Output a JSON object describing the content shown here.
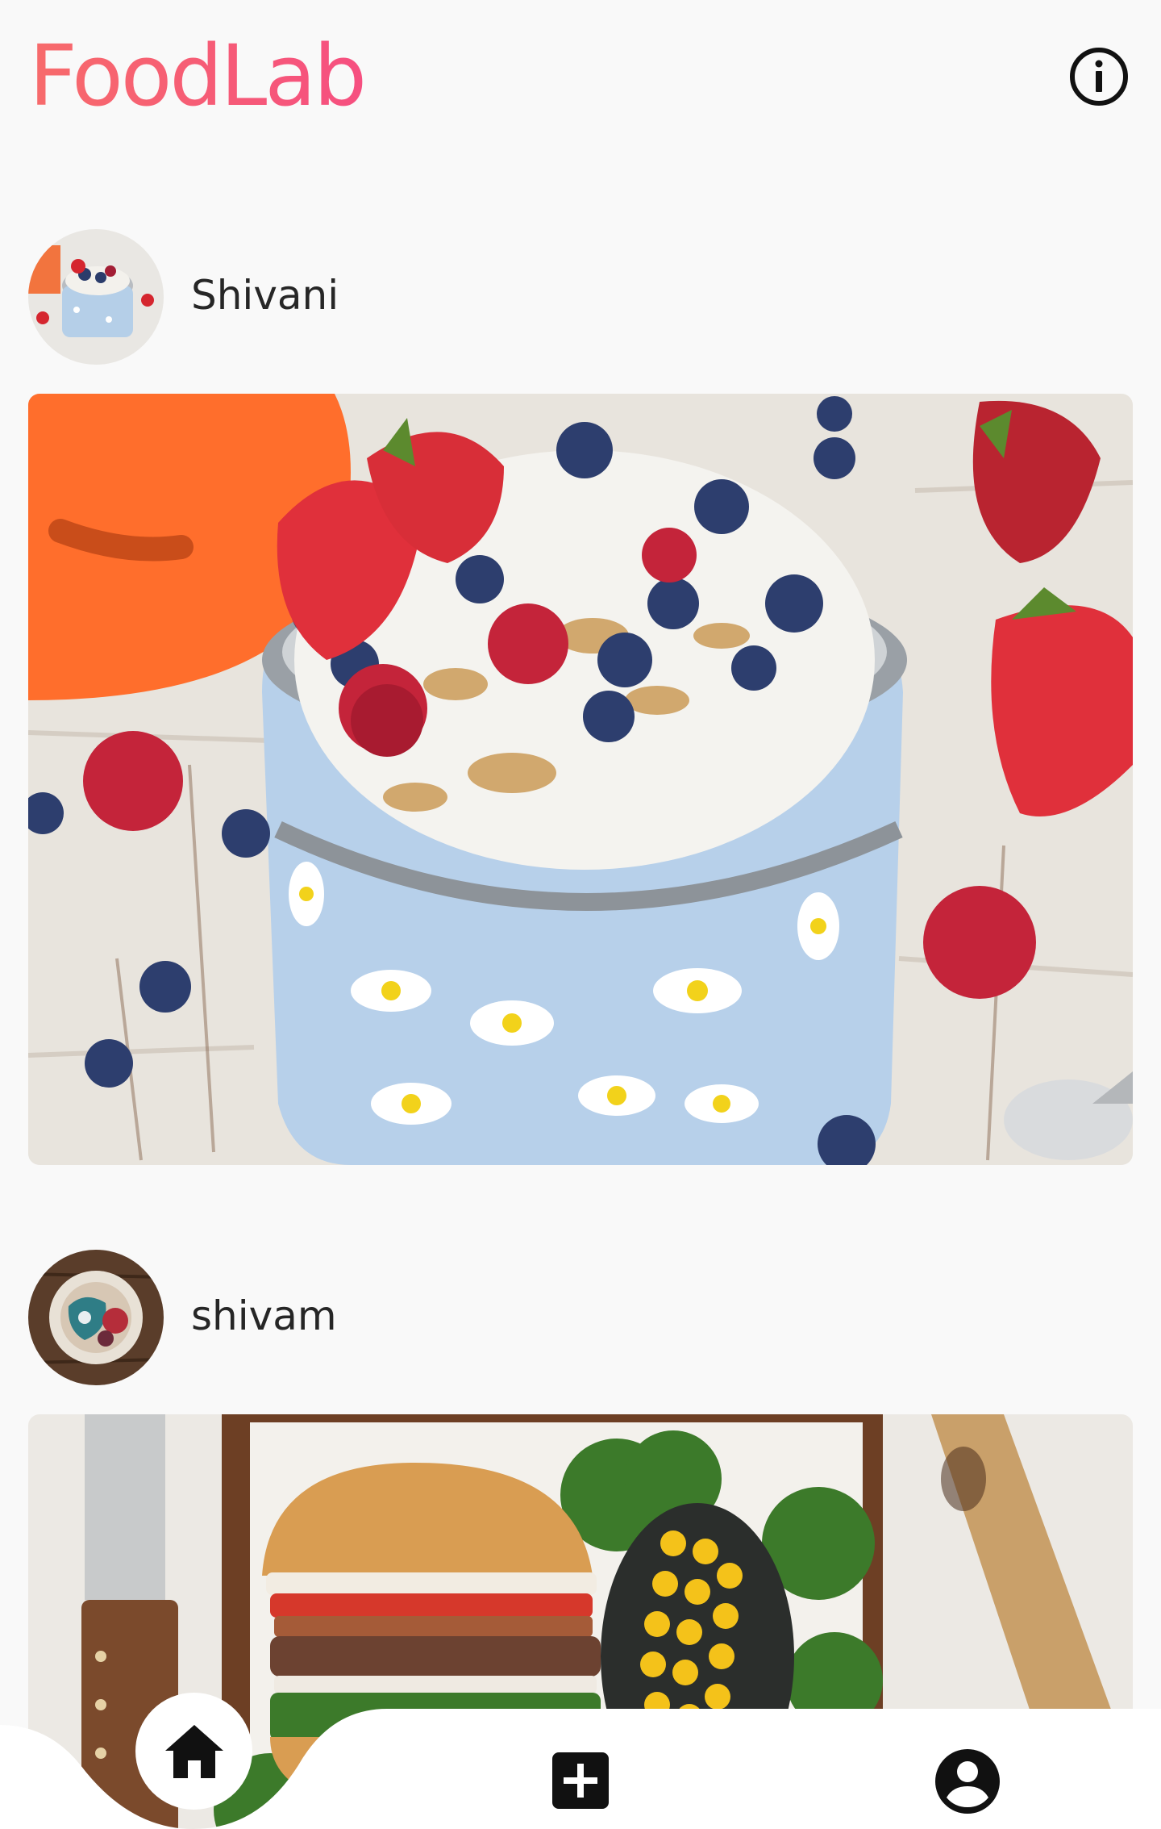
{
  "app": {
    "title": "FoodLab"
  },
  "header": {
    "info_icon": "info-circle-icon"
  },
  "posts": [
    {
      "username": "Shivani",
      "image_alt": "Yogurt bowl with granola, blueberries, raspberries and strawberries"
    },
    {
      "username": "shivam",
      "image_alt": "Burger with kale and corn on wooden tray"
    }
  ],
  "bottom_nav": {
    "items": [
      {
        "icon": "home-icon",
        "active": true
      },
      {
        "icon": "add-box-icon",
        "active": false
      },
      {
        "icon": "account-circle-icon",
        "active": false
      }
    ]
  },
  "colors": {
    "brand_start": "#f76b6b",
    "brand_end": "#f64f80",
    "background": "#f9f9f9",
    "text": "#262626",
    "icon": "#111111"
  }
}
